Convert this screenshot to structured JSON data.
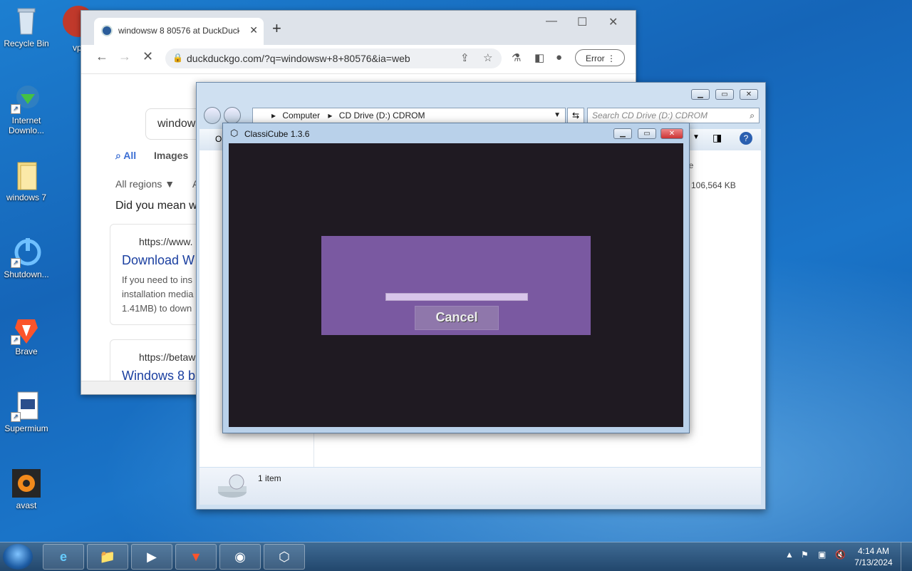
{
  "desktop": {
    "icons": [
      {
        "label": "Recycle Bin",
        "icon": "recycle-bin-icon"
      },
      {
        "label": "Internet Downlo...",
        "icon": "internet-download-manager-icon"
      },
      {
        "label": "windows 7",
        "icon": "folder-icon"
      },
      {
        "label": "Shutdown...",
        "icon": "power-icon"
      },
      {
        "label": "Brave",
        "icon": "brave-icon"
      },
      {
        "label": "Supermium",
        "icon": "supermium-icon"
      },
      {
        "label": "avast",
        "icon": "avast-icon"
      }
    ],
    "partial_icon_label": "vp"
  },
  "chrome": {
    "tab_title": "windowsw 8 80576 at DuckDuck",
    "url": "duckduckgo.com/?q=windowsw+8+80576&ia=web",
    "error_label": "Error",
    "search_value": "windows",
    "tabs": [
      "All",
      "Images"
    ],
    "region_filter": "All regions",
    "region_filter_extra": "A",
    "did_you_mean": "Did you mean w",
    "results": [
      {
        "url": "https://www.",
        "title": "Download W",
        "snippet": [
          "If you need to ins",
          "installation media",
          "1.41MB) to down"
        ]
      },
      {
        "url": "https://betaw",
        "title": "Windows 8 b"
      }
    ]
  },
  "explorer": {
    "breadcrumb": [
      "Computer",
      "CD Drive (D:) CDROM"
    ],
    "search_placeholder": "Search CD Drive (D:) CDROM",
    "cmd_partial": "O",
    "col_header_partial": "ize",
    "file_size": "106,564 KB",
    "status_count": "1 item"
  },
  "classicube": {
    "title": "ClassiCube 1.3.6",
    "progress": 0.0,
    "cancel_label": "Cancel"
  },
  "taskbar": {
    "clock_time": "4:14 AM",
    "clock_date": "7/13/2024",
    "items": [
      "internet-explorer-icon",
      "explorer-icon",
      "media-player-icon",
      "brave-icon",
      "supermium-icon",
      "classicube-icon"
    ]
  }
}
